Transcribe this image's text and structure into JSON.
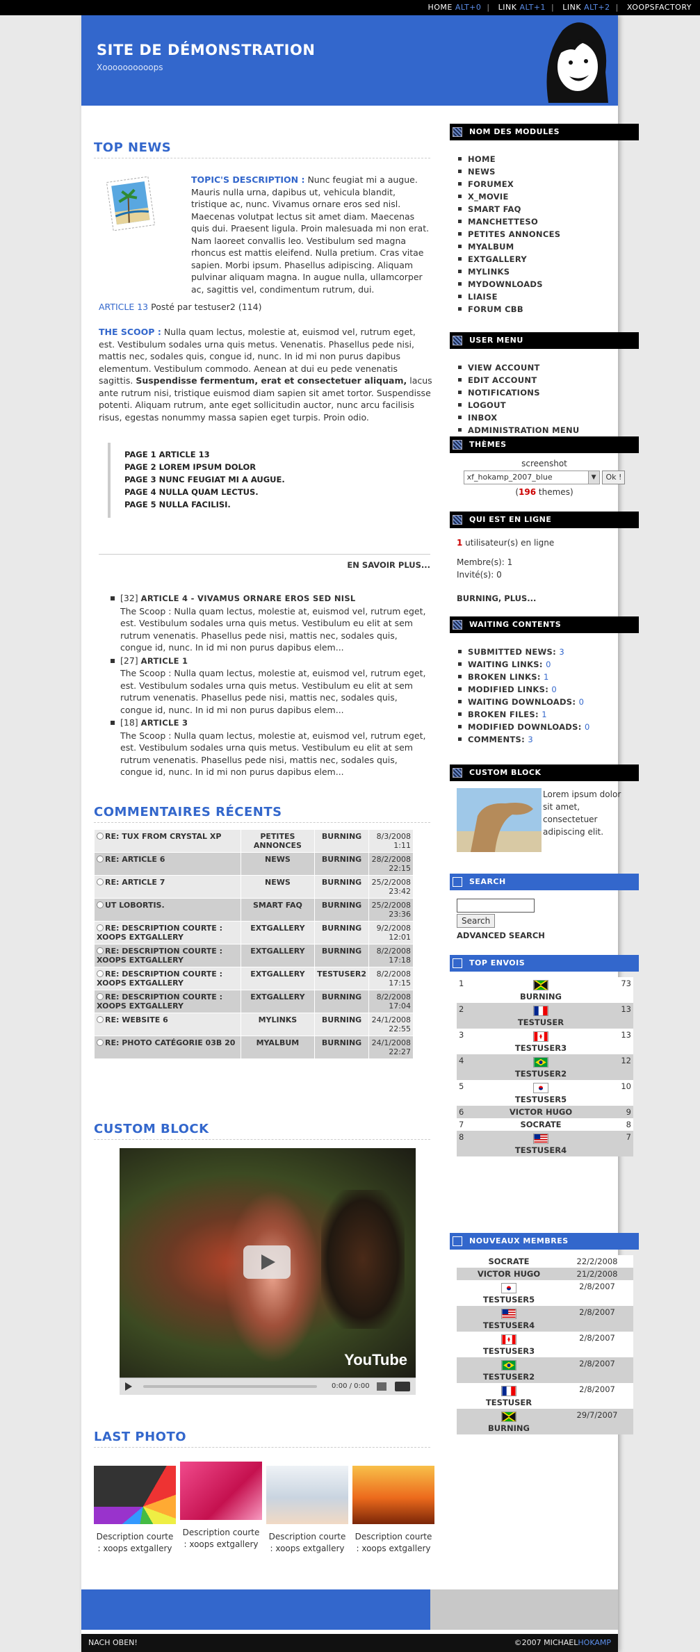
{
  "topbar": [
    {
      "label": "HOME",
      "key": "ALT+0"
    },
    {
      "label": "LINK",
      "key": "ALT+1"
    },
    {
      "label": "LINK",
      "key": "ALT+2"
    },
    {
      "label": "XOOPSFACTORY",
      "key": ""
    }
  ],
  "header": {
    "title": "SITE DE DÉMONSTRATION",
    "slogan": "Xoooooooooops"
  },
  "top_news": {
    "heading": "TOP NEWS",
    "topic_label": "TOPIC'S DESCRIPTION :",
    "topic_text": "Nunc feugiat mi a augue. Mauris nulla urna, dapibus ut, vehicula blandit, tristique ac, nunc. Vivamus ornare eros sed nisl. Maecenas volutpat lectus sit amet diam. Maecenas quis dui. Praesent ligula. Proin malesuada mi non erat. Nam laoreet convallis leo. Vestibulum sed magna rhoncus est mattis eleifend. Nulla pretium. Cras vitae sapien. Morbi ipsum. Phasellus adipiscing. Aliquam pulvinar aliquam magna. In augue nulla, ullamcorper ac, sagittis vel, condimentum rutrum, dui.",
    "article_link": "ARTICLE 13",
    "posted": "Posté par testuser2 (114)",
    "scoop_label": "THE SCOOP :",
    "scoop_text_1": "Nulla quam lectus, molestie at, euismod vel, rutrum eget, est. Vestibulum sodales urna quis metus. Venenatis. Phasellus pede nisi, mattis nec, sodales quis, congue id, nunc. In id mi non purus dapibus elementum. Vestibulum commodo. Aenean at dui eu pede venenatis sagittis.",
    "scoop_bold": "Suspendisse fermentum, erat et consectetuer aliquam,",
    "scoop_text_2": "lacus ante rutrum nisi, tristique euismod diam sapien sit amet tortor. Suspendisse potenti. Aliquam rutrum, ante eget sollicitudin auctor, nunc arcu facilisis risus, egestas nonummy massa sapien eget turpis. Proin odio.",
    "pages": [
      "PAGE 1 ARTICLE 13",
      "PAGE 2 LOREM IPSUM DOLOR",
      "PAGE 3 NUNC FEUGIAT MI A AUGUE.",
      "PAGE 4 NULLA QUAM LECTUS.",
      "PAGE 5 NULLA FACILISI."
    ],
    "more": "EN SAVOIR PLUS...",
    "articles": [
      {
        "count": "[32]",
        "title": "ARTICLE 4 - VIVAMUS ORNARE EROS SED NISL",
        "text": "The Scoop : Nulla quam lectus, molestie at, euismod vel, rutrum eget, est. Vestibulum sodales urna quis metus. Vestibulum eu elit at sem rutrum venenatis. Phasellus pede nisi, mattis nec, sodales quis, congue id, nunc. In id mi non purus dapibus elem..."
      },
      {
        "count": "[27]",
        "title": "ARTICLE 1",
        "text": "The Scoop : Nulla quam lectus, molestie at, euismod vel, rutrum eget, est. Vestibulum sodales urna quis metus. Vestibulum eu elit at sem rutrum venenatis. Phasellus pede nisi, mattis nec, sodales quis, congue id, nunc. In id mi non purus dapibus elem..."
      },
      {
        "count": "[18]",
        "title": "ARTICLE 3",
        "text": "The Scoop : Nulla quam lectus, molestie at, euismod vel, rutrum eget, est. Vestibulum sodales urna quis metus. Vestibulum eu elit at sem rutrum venenatis. Phasellus pede nisi, mattis nec, sodales quis, congue id, nunc. In id mi non purus dapibus elem..."
      }
    ]
  },
  "comments": {
    "heading": "COMMENTAIRES RÉCENTS",
    "rows": [
      {
        "title": "RE: TUX FROM CRYSTAL XP",
        "module": "PETITES ANNONCES",
        "user": "BURNING",
        "date": "8/3/2008",
        "time": "1:11"
      },
      {
        "title": "RE: ARTICLE 6",
        "module": "NEWS",
        "user": "BURNING",
        "date": "28/2/2008",
        "time": "22:15"
      },
      {
        "title": "RE: ARTICLE 7",
        "module": "NEWS",
        "user": "BURNING",
        "date": "25/2/2008",
        "time": "23:42"
      },
      {
        "title": "UT LOBORTIS.",
        "module": "SMART FAQ",
        "user": "BURNING",
        "date": "25/2/2008",
        "time": "23:36"
      },
      {
        "title": "RE: DESCRIPTION COURTE : XOOPS EXTGALLERY",
        "module": "EXTGALLERY",
        "user": "BURNING",
        "date": "9/2/2008",
        "time": "12:01"
      },
      {
        "title": "RE: DESCRIPTION COURTE : XOOPS EXTGALLERY",
        "module": "EXTGALLERY",
        "user": "BURNING",
        "date": "8/2/2008",
        "time": "17:18"
      },
      {
        "title": "RE: DESCRIPTION COURTE : XOOPS EXTGALLERY",
        "module": "EXTGALLERY",
        "user": "TESTUSER2",
        "date": "8/2/2008",
        "time": "17:15"
      },
      {
        "title": "RE: DESCRIPTION COURTE : XOOPS EXTGALLERY",
        "module": "EXTGALLERY",
        "user": "BURNING",
        "date": "8/2/2008",
        "time": "17:04"
      },
      {
        "title": "RE: WEBSITE 6",
        "module": "MYLINKS",
        "user": "BURNING",
        "date": "24/1/2008",
        "time": "22:55"
      },
      {
        "title": "RE: PHOTO CATÉGORIE 03B 20",
        "module": "MYALBUM",
        "user": "BURNING",
        "date": "24/1/2008",
        "time": "22:27"
      }
    ]
  },
  "custom_block_main": {
    "heading": "CUSTOM BLOCK",
    "video_time": "0:00 / 0:00",
    "video_logo": "YouTube"
  },
  "last_photo": {
    "heading": "LAST PHOTO",
    "items": [
      {
        "caption": "Description courte : xoops extgallery"
      },
      {
        "caption": "Description courte : xoops extgallery"
      },
      {
        "caption": "Description courte : xoops extgallery"
      },
      {
        "caption": "Description courte : xoops extgallery"
      }
    ]
  },
  "footer": {
    "left": "NACH OBEN!",
    "right_prefix": "©2007 MICHAEL",
    "right_name": "HOKAMP"
  },
  "modules": {
    "heading": "NOM DES MODULES",
    "items": [
      "HOME",
      "NEWS",
      "FORUMEX",
      "X_MOVIE",
      "SMART FAQ",
      "MANCHETTESO",
      "PETITES ANNONCES",
      "MYALBUM",
      "EXTGALLERY",
      "MYLINKS",
      "MYDOWNLOADS",
      "LIAISE",
      "FORUM CBB"
    ]
  },
  "user_menu": {
    "heading": "USER MENU",
    "items": [
      "VIEW ACCOUNT",
      "EDIT ACCOUNT",
      "NOTIFICATIONS",
      "LOGOUT",
      "INBOX",
      "ADMINISTRATION MENU"
    ]
  },
  "themes": {
    "heading": "THÈMES",
    "label": "screenshot",
    "selected": "xf_hokamp_2007_blue",
    "ok": "Ok !",
    "count": "196",
    "count_suffix": " themes)"
  },
  "online": {
    "heading": "QUI EST EN LIGNE",
    "count": "1",
    "count_text": " utilisateur(s) en ligne",
    "members": "Membre(s): 1",
    "guests": "Invité(s): 0",
    "names": "BURNING, PLUS..."
  },
  "waiting": {
    "heading": "WAITING CONTENTS",
    "items": [
      {
        "label": "SUBMITTED NEWS:",
        "value": "3"
      },
      {
        "label": "WAITING LINKS:",
        "value": "0"
      },
      {
        "label": "BROKEN LINKS:",
        "value": "1"
      },
      {
        "label": "MODIFIED LINKS:",
        "value": "0"
      },
      {
        "label": "WAITING DOWNLOADS:",
        "value": "0"
      },
      {
        "label": "BROKEN FILES:",
        "value": "1"
      },
      {
        "label": "MODIFIED DOWNLOADS:",
        "value": "0"
      },
      {
        "label": "COMMENTS:",
        "value": "3"
      }
    ]
  },
  "custom_block_side": {
    "heading": "CUSTOM BLOCK",
    "text": "Lorem ipsum dolor sit amet, consectetuer adipiscing elit."
  },
  "search": {
    "heading": "SEARCH",
    "button": "Search",
    "advanced": "ADVANCED SEARCH"
  },
  "top_envois": {
    "heading": "TOP ENVOIS",
    "rows": [
      {
        "rank": "1",
        "name": "BURNING",
        "count": "73",
        "flag": "jamaica"
      },
      {
        "rank": "2",
        "name": "TESTUSER",
        "count": "13",
        "flag": "france"
      },
      {
        "rank": "3",
        "name": "TESTUSER3",
        "count": "13",
        "flag": "canada"
      },
      {
        "rank": "4",
        "name": "TESTUSER2",
        "count": "12",
        "flag": "brazil"
      },
      {
        "rank": "5",
        "name": "TESTUSER5",
        "count": "10",
        "flag": "korea"
      },
      {
        "rank": "6",
        "name": "VICTOR HUGO",
        "count": "9",
        "flag": ""
      },
      {
        "rank": "7",
        "name": "SOCRATE",
        "count": "8",
        "flag": ""
      },
      {
        "rank": "8",
        "name": "TESTUSER4",
        "count": "7",
        "flag": "usa"
      }
    ]
  },
  "new_members": {
    "heading": "NOUVEAUX MEMBRES",
    "rows": [
      {
        "name": "SOCRATE",
        "date": "22/2/2008",
        "flag": ""
      },
      {
        "name": "VICTOR HUGO",
        "date": "21/2/2008",
        "flag": ""
      },
      {
        "name": "TESTUSER5",
        "date": "2/8/2007",
        "flag": "korea"
      },
      {
        "name": "TESTUSER4",
        "date": "2/8/2007",
        "flag": "usa"
      },
      {
        "name": "TESTUSER3",
        "date": "2/8/2007",
        "flag": "canada"
      },
      {
        "name": "TESTUSER2",
        "date": "2/8/2007",
        "flag": "brazil"
      },
      {
        "name": "TESTUSER",
        "date": "2/8/2007",
        "flag": "france"
      },
      {
        "name": "BURNING",
        "date": "29/7/2007",
        "flag": "jamaica"
      }
    ]
  },
  "colors": {
    "accent": "#3367cc",
    "header": "#3367cc",
    "block_header": "#000000",
    "count_red": "#cc0000"
  }
}
